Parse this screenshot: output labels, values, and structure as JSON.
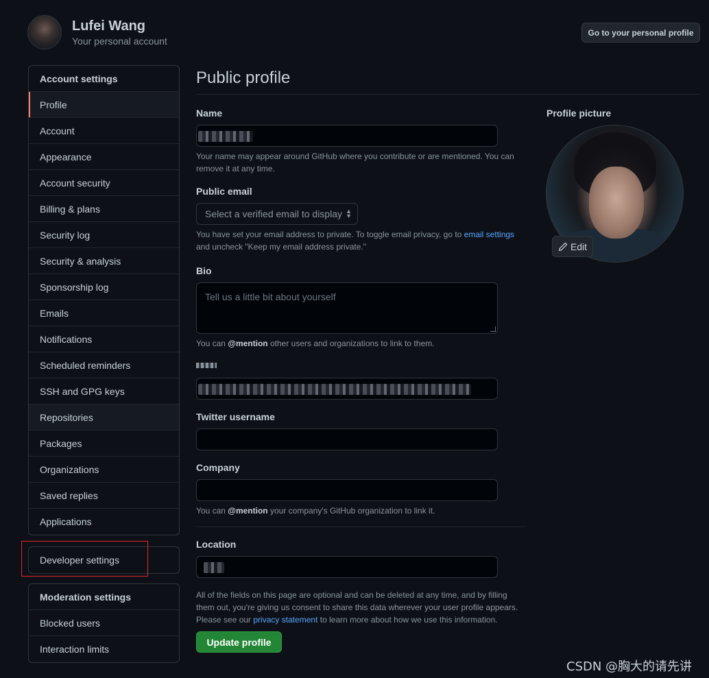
{
  "header": {
    "user_name": "Lufei Wang",
    "user_subtitle": "Your personal account",
    "personal_profile_button": "Go to your personal profile"
  },
  "sidebar": {
    "account_heading": "Account settings",
    "items": [
      {
        "label": "Profile",
        "selected": true
      },
      {
        "label": "Account"
      },
      {
        "label": "Appearance"
      },
      {
        "label": "Account security"
      },
      {
        "label": "Billing & plans"
      },
      {
        "label": "Security log"
      },
      {
        "label": "Security & analysis"
      },
      {
        "label": "Sponsorship log"
      },
      {
        "label": "Emails"
      },
      {
        "label": "Notifications"
      },
      {
        "label": "Scheduled reminders"
      },
      {
        "label": "SSH and GPG keys"
      },
      {
        "label": "Repositories"
      },
      {
        "label": "Packages"
      },
      {
        "label": "Organizations"
      },
      {
        "label": "Saved replies"
      },
      {
        "label": "Applications"
      }
    ],
    "developer_settings": "Developer settings",
    "moderation_heading": "Moderation settings",
    "moderation_items": [
      {
        "label": "Blocked users"
      },
      {
        "label": "Interaction limits"
      }
    ]
  },
  "main": {
    "title": "Public profile",
    "name_label": "Name",
    "name_note": "Your name may appear around GitHub where you contribute or are mentioned. You can remove it at any time.",
    "email_label": "Public email",
    "email_select": "Select a verified email to display",
    "email_note_pre": "You have set your email address to private. To toggle email privacy, go to ",
    "email_note_link": "email settings",
    "email_note_post": " and uncheck \"Keep my email address private.\"",
    "bio_label": "Bio",
    "bio_placeholder": "Tell us a little bit about yourself",
    "bio_note_pre": "You can ",
    "bio_note_bold": "@mention",
    "bio_note_post": " other users and organizations to link to them.",
    "twitter_label": "Twitter username",
    "company_label": "Company",
    "company_note_pre": "You can ",
    "company_note_bold": "@mention",
    "company_note_post": " your company's GitHub organization to link it.",
    "location_label": "Location",
    "footer_note_pre": "All of the fields on this page are optional and can be deleted at any time, and by filling them out, you're giving us consent to share this data wherever your user profile appears. Please see our ",
    "footer_note_link": "privacy statement",
    "footer_note_post": " to learn more about how we use this information.",
    "update_button": "Update profile"
  },
  "profile_picture": {
    "label": "Profile picture",
    "edit_button": "Edit"
  },
  "watermark": "CSDN @胸大的请先讲",
  "colors": {
    "background": "#0d1117",
    "accent_selected": "#f78166",
    "link": "#58a6ff",
    "primary_button": "#238636",
    "highlight_box": "#e5262e"
  }
}
